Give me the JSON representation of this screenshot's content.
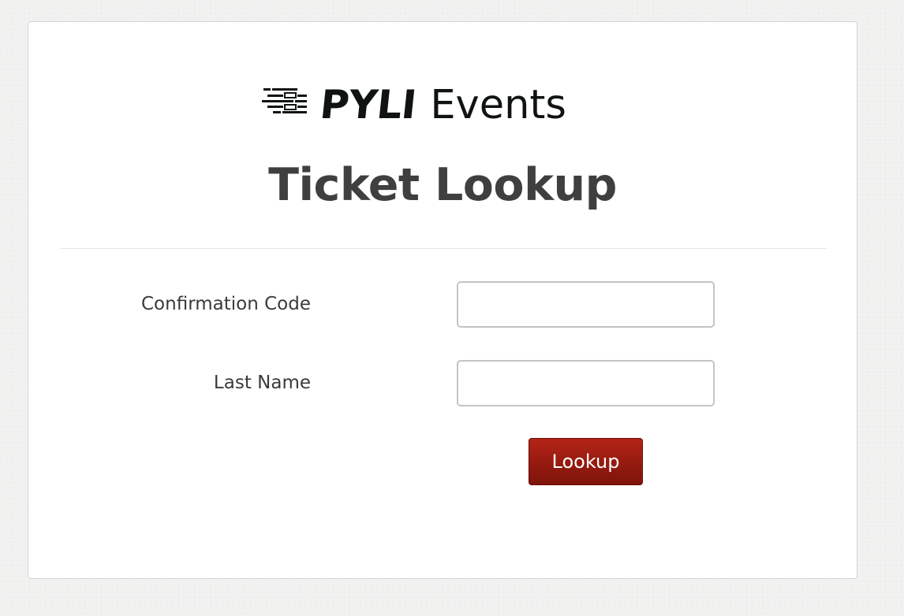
{
  "brand": {
    "name": "PYLI",
    "suffix": "Events"
  },
  "page": {
    "title": "Ticket Lookup"
  },
  "form": {
    "confirmation_code": {
      "label": "Confirmation Code",
      "value": "",
      "placeholder": ""
    },
    "last_name": {
      "label": "Last Name",
      "value": "",
      "placeholder": ""
    },
    "submit_label": "Lookup"
  },
  "icons": {
    "logo_mark": "speed-lines-icon"
  },
  "colors": {
    "button_bg": "#951a10",
    "button_text": "#ffffff",
    "title_text": "#3f3f3f",
    "logo_text": "#0f1412",
    "page_bg": "#f1f1f0"
  }
}
